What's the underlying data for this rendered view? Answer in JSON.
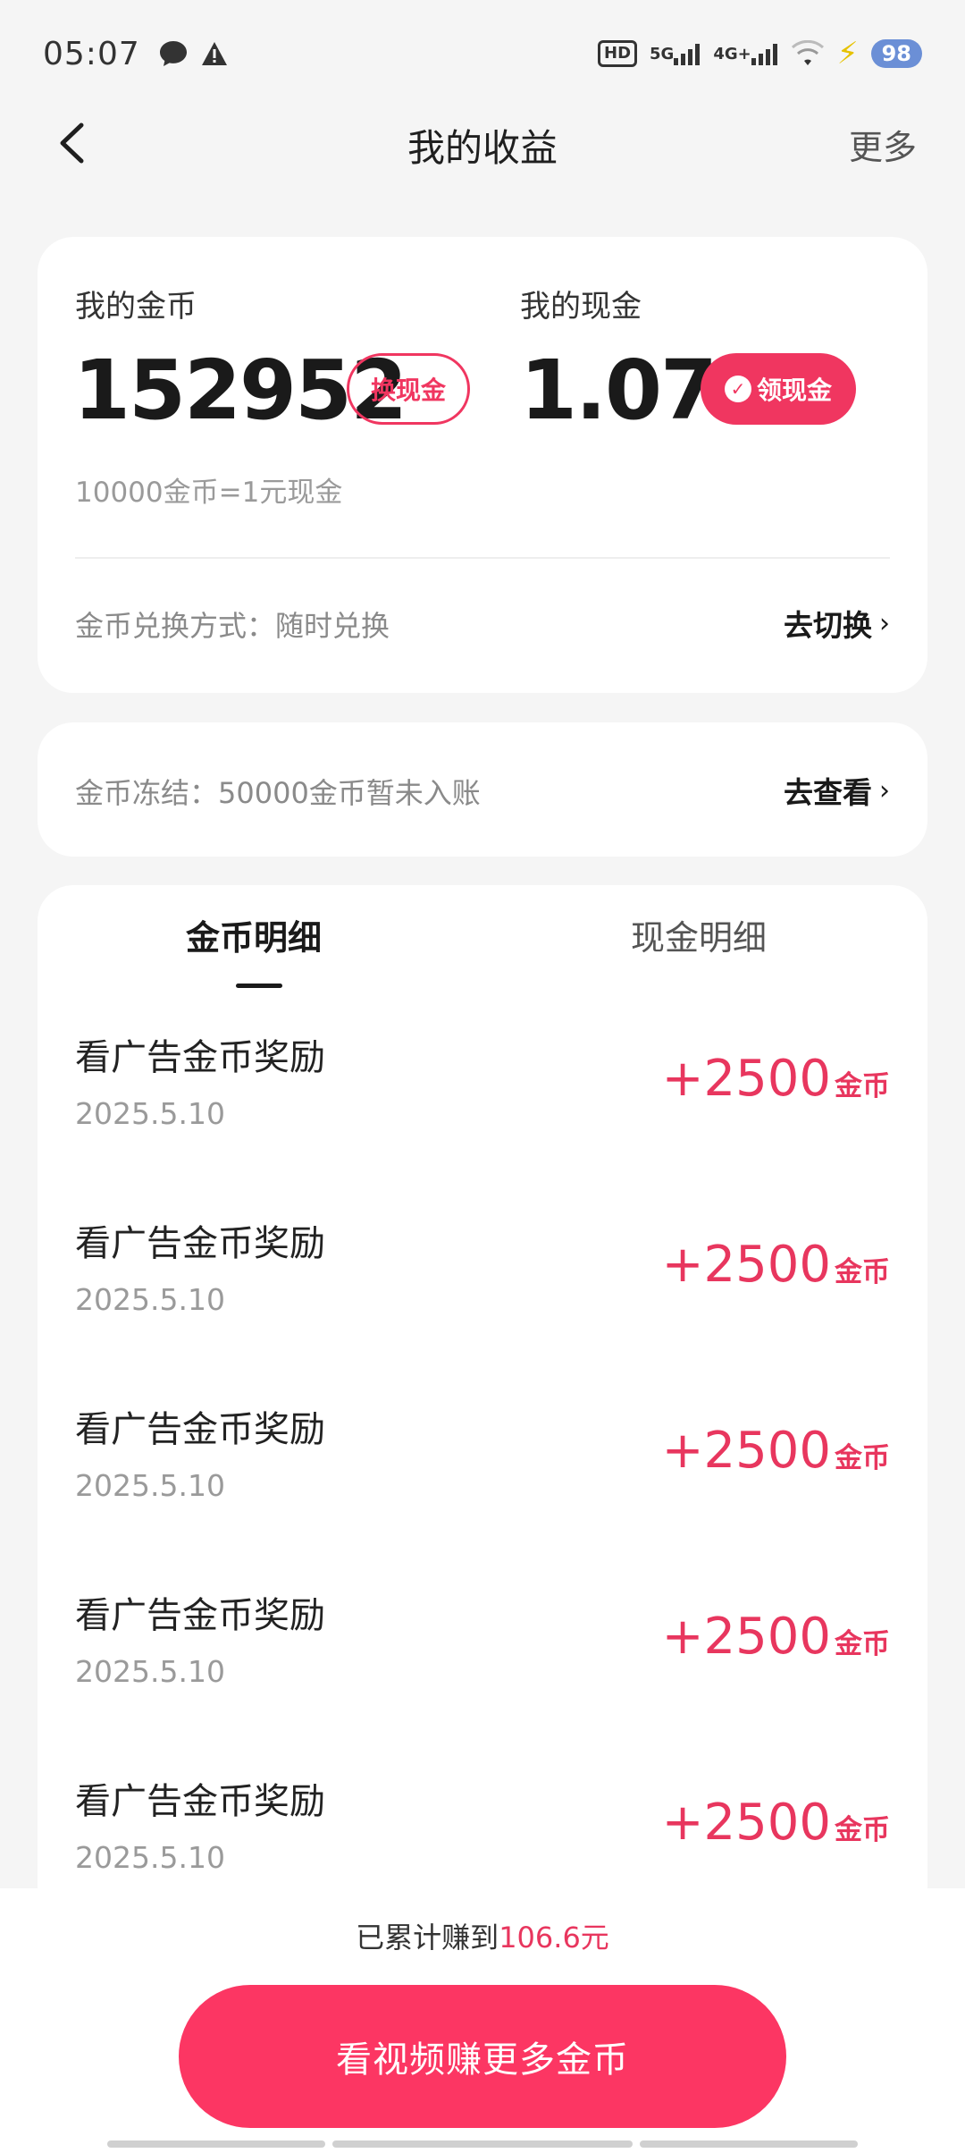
{
  "status_bar": {
    "time": "05:07",
    "icons": [
      "chat-bubble-icon",
      "warning-icon"
    ],
    "hd_label": "HD",
    "net1": "5G",
    "net2": "4G+",
    "battery": "98"
  },
  "nav": {
    "title": "我的收益",
    "more": "更多"
  },
  "earnings": {
    "coins_label": "我的金币",
    "coins_value": "152952",
    "exchange_button": "换现金",
    "cash_label": "我的现金",
    "cash_value": "1.07",
    "withdraw_button": "领现金",
    "rate": "10000金币=1元现金",
    "method": "金币兑换方式：随时兑换",
    "method_link": "去切换"
  },
  "freeze": {
    "text": "金币冻结：50000金币暂未入账",
    "link": "去查看"
  },
  "tabs": {
    "coins": "金币明细",
    "cash": "现金明细"
  },
  "records": [
    {
      "title": "看广告金币奖励",
      "date": "2025.5.10",
      "amount": "+2500",
      "unit": "金币"
    },
    {
      "title": "看广告金币奖励",
      "date": "2025.5.10",
      "amount": "+2500",
      "unit": "金币"
    },
    {
      "title": "看广告金币奖励",
      "date": "2025.5.10",
      "amount": "+2500",
      "unit": "金币"
    },
    {
      "title": "看广告金币奖励",
      "date": "2025.5.10",
      "amount": "+2500",
      "unit": "金币"
    },
    {
      "title": "看广告金币奖励",
      "date": "2025.5.10",
      "amount": "+2500",
      "unit": "金币"
    }
  ],
  "footer": {
    "earned_prefix": "已累计赚到",
    "earned_amount": "106.6元",
    "cta": "看视频赚更多金币"
  },
  "colors": {
    "accent": "#f03660",
    "cta": "#fc3663",
    "background": "#f5f5f5"
  }
}
